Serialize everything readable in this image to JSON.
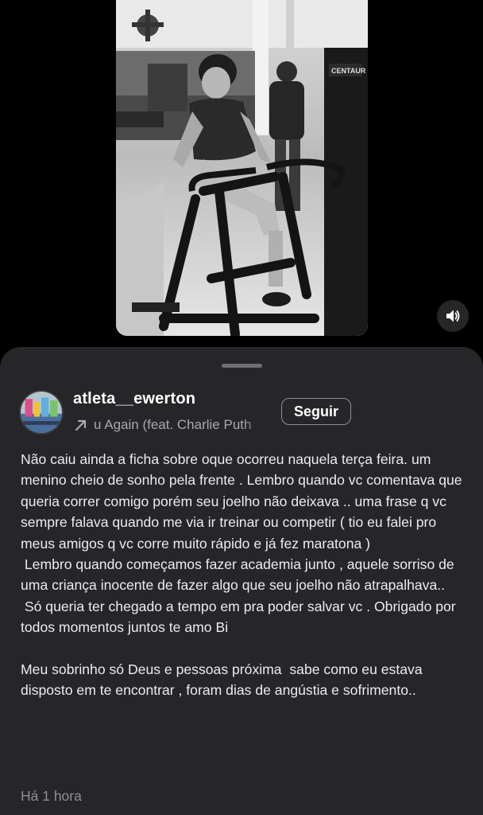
{
  "video": {
    "mute_icon": "speaker-icon",
    "machine_brand": "CENTAUR"
  },
  "post": {
    "username": "atleta__ewerton",
    "audio_icon": "arrow-up-right-icon",
    "audio_track": "u Again (feat. Charlie Puth",
    "follow_label": "Seguir",
    "caption": [
      "Não caiu ainda a ficha sobre oque ocorreu naquela terça feira. um menino cheio de sonho pela frente . Lembro quando vc comentava que queria correr comigo porém seu joelho não deixava .. uma frase q vc sempre falava quando me via ir treinar ou competir ( tio eu falei pro meus amigos q vc corre muito rápido e já fez maratona )",
      " Lembro quando começamos fazer academia junto , aquele sorriso de uma criança inocente de fazer algo que seu joelho não atrapalhava..",
      " Só queria ter chegado a tempo em pra poder salvar vc . Obrigado por todos momentos juntos te amo Bi",
      "",
      "Meu sobrinho só Deus e pessoas próxima  sabe como eu estava disposto em te encontrar , foram dias de angústia e sofrimento.."
    ],
    "timestamp": "Há 1 hora"
  },
  "colors": {
    "background": "#000000",
    "sheet": "#262629",
    "text": "#ececec",
    "secondary_text": "#8e8e93"
  }
}
